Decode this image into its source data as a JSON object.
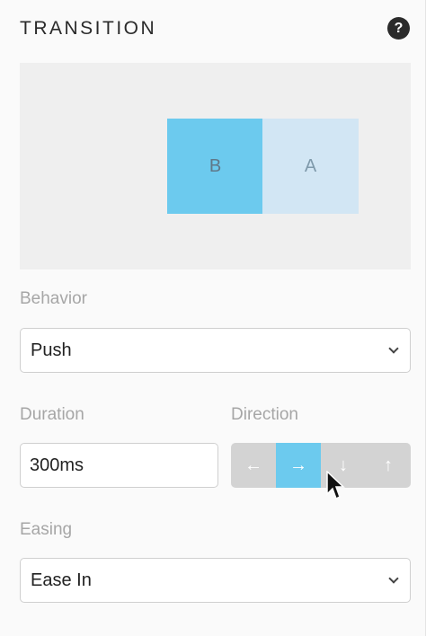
{
  "header": {
    "title": "TRANSITION",
    "help_glyph": "?"
  },
  "preview": {
    "slide_b": "B",
    "slide_a": "A"
  },
  "behavior": {
    "label": "Behavior",
    "value": "Push"
  },
  "duration": {
    "label": "Duration",
    "value": "300ms"
  },
  "direction": {
    "label": "Direction",
    "options": [
      "←",
      "→",
      "↓",
      "↑"
    ],
    "selected": "→"
  },
  "easing": {
    "label": "Easing",
    "value": "Ease In"
  },
  "colors": {
    "accent": "#6ccaee",
    "slide_light": "#d2e6f4"
  }
}
